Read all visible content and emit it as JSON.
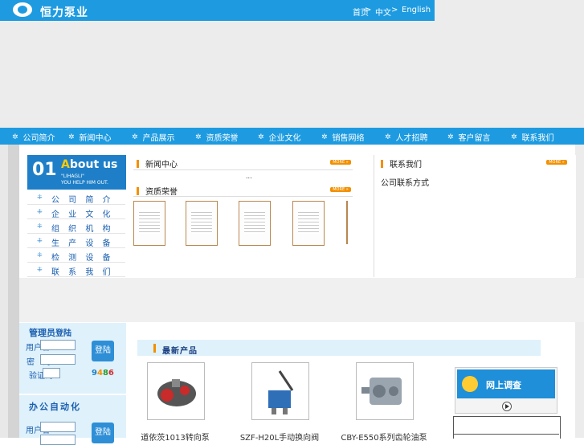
{
  "header": {
    "logo_text": "恒力泵业",
    "nav": [
      "首页",
      ">",
      "中文",
      ">",
      "English"
    ]
  },
  "mainnav": [
    "公司简介",
    "新闻中心",
    "产品展示",
    "资质荣誉",
    "企业文化",
    "销售网络",
    "人才招聘",
    "客户留言",
    "联系我们"
  ],
  "about": {
    "num": "01",
    "title_first": "A",
    "title_rest": "bout us",
    "sub1": "\"LIHAGLI\"",
    "sub2": "YOU HELP HIM OUT."
  },
  "leftmenu": [
    "公 司 简 介",
    "企 业 文 化",
    "组 织 机 构",
    "生 产 设 备",
    "检 测 设 备",
    "联 系 我 们"
  ],
  "news": {
    "title": "新闻中心",
    "more": "MORE »",
    "ellipsis": "..."
  },
  "honors": {
    "title": "资质荣誉",
    "more": "MORE »"
  },
  "contact": {
    "title": "联系我们",
    "more": "MORE »",
    "text": "公司联系方式"
  },
  "login": {
    "title_a": "管理员",
    "title_b": "登陆",
    "user_label": "用户名",
    "pass_label": "密　码",
    "code_label": "验证码",
    "button": "登陆",
    "code_digits": [
      "9",
      "4",
      "8",
      "6"
    ]
  },
  "office": {
    "title": "办公自动化",
    "user_label": "用户名",
    "button": "登陆"
  },
  "products": {
    "title": "最新产品",
    "items": [
      "道依茨1013转向泵",
      "SZF-H20L手动换向阀",
      "CBY-E550系列齿轮油泵"
    ]
  },
  "survey": {
    "title": "网上调查"
  },
  "colors": {
    "brand_blue": "#1e9be0",
    "accent_orange": "#f29000",
    "code": [
      "#1e7fc8",
      "#f29000",
      "#2a9a2a",
      "#d03030"
    ]
  }
}
